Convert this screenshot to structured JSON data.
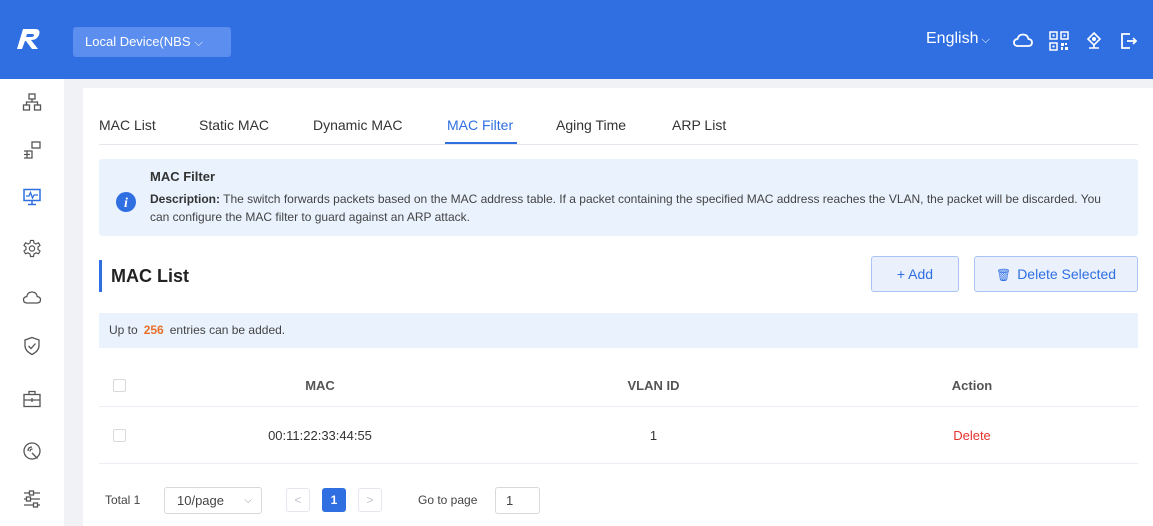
{
  "header": {
    "device_select": "Local Device(NBS",
    "language": "English"
  },
  "icons": {
    "logo": "ruijie-r-logo",
    "cloud": "cloud-icon",
    "qrcode": "qr-code-icon",
    "network": "network-icon",
    "logout": "logout-icon"
  },
  "sidebar": {
    "items": [
      "topology",
      "ports",
      "monitor",
      "settings",
      "cloud",
      "security",
      "toolbox",
      "wireless",
      "more"
    ]
  },
  "tabs": [
    {
      "label": "MAC List"
    },
    {
      "label": "Static MAC"
    },
    {
      "label": "Dynamic MAC"
    },
    {
      "label": "MAC Filter",
      "active": true
    },
    {
      "label": "Aging Time"
    },
    {
      "label": "ARP List"
    }
  ],
  "notice": {
    "title": "MAC Filter",
    "desc_label": "Description:",
    "desc_text": " The switch forwards packets based on the MAC address table. If a packet containing the specified MAC address reaches the VLAN, the packet will be discarded. You can configure the MAC filter to guard against an ARP attack."
  },
  "section": {
    "title": "MAC List",
    "add_label": "+ Add",
    "delete_selected_label": "Delete Selected"
  },
  "limit": {
    "prefix": "Up to",
    "count": "256",
    "suffix": "entries can be added."
  },
  "table": {
    "columns": [
      "MAC",
      "VLAN ID",
      "Action"
    ],
    "rows": [
      {
        "mac": "00:11:22:33:44:55",
        "vlan": "1",
        "action": "Delete"
      }
    ]
  },
  "pagination": {
    "total": "Total 1",
    "page_size": "10/page",
    "current_page": "1",
    "goto_label": "Go to page",
    "goto_value": "1"
  },
  "colors": {
    "primary": "#2f6fe2",
    "danger": "#e5322d",
    "highlight": "#e8702a",
    "info_bg": "#e9f2fd"
  }
}
